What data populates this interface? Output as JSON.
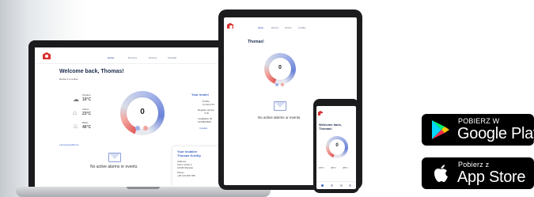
{
  "app": {
    "welcome": "Welcome back, Thomas!",
    "subtitle": "Device 1 is online",
    "phone_welcome_line1": "Welcome back,",
    "phone_welcome_line2": "Thomas!",
    "nav_tabs": [
      "Home",
      "Devices",
      "History",
      "Installer"
    ],
    "user_menu": "Thomas M.",
    "weather": [
      {
        "label": "Outdoor",
        "temp": "16°C"
      },
      {
        "label": "Indoor",
        "temp": "23°C"
      },
      {
        "label": "Boiler",
        "temp": "46°C"
      }
    ],
    "gauge_value": "0",
    "your_model_heading": "Your model",
    "model_lines": [
      "Profile",
      "Comfort 24",
      "Regular service",
      "3.15",
      "Installation ID",
      "1234567890"
    ],
    "installer_link": "Installer",
    "last_events_link": "Last Events/Errors",
    "no_alarms": "No active alarms or events.",
    "your_installer_heading": "Your installer",
    "installer_name": "Thomas Kroliky",
    "installer_lines": [
      "Address",
      "Some street 1",
      "12345 Warsaw",
      "Phone",
      "+48 123 456 789"
    ]
  },
  "badges": {
    "google": {
      "top": "POBIERZ W",
      "main": "Google Play"
    },
    "apple": {
      "top": "Pobierz z",
      "main": "App Store"
    }
  },
  "colors": {
    "accent": "#3d63c9",
    "brand_red": "#d8302f",
    "gauge_red": "#e35a5a",
    "gauge_blue": "#6b83d9"
  }
}
